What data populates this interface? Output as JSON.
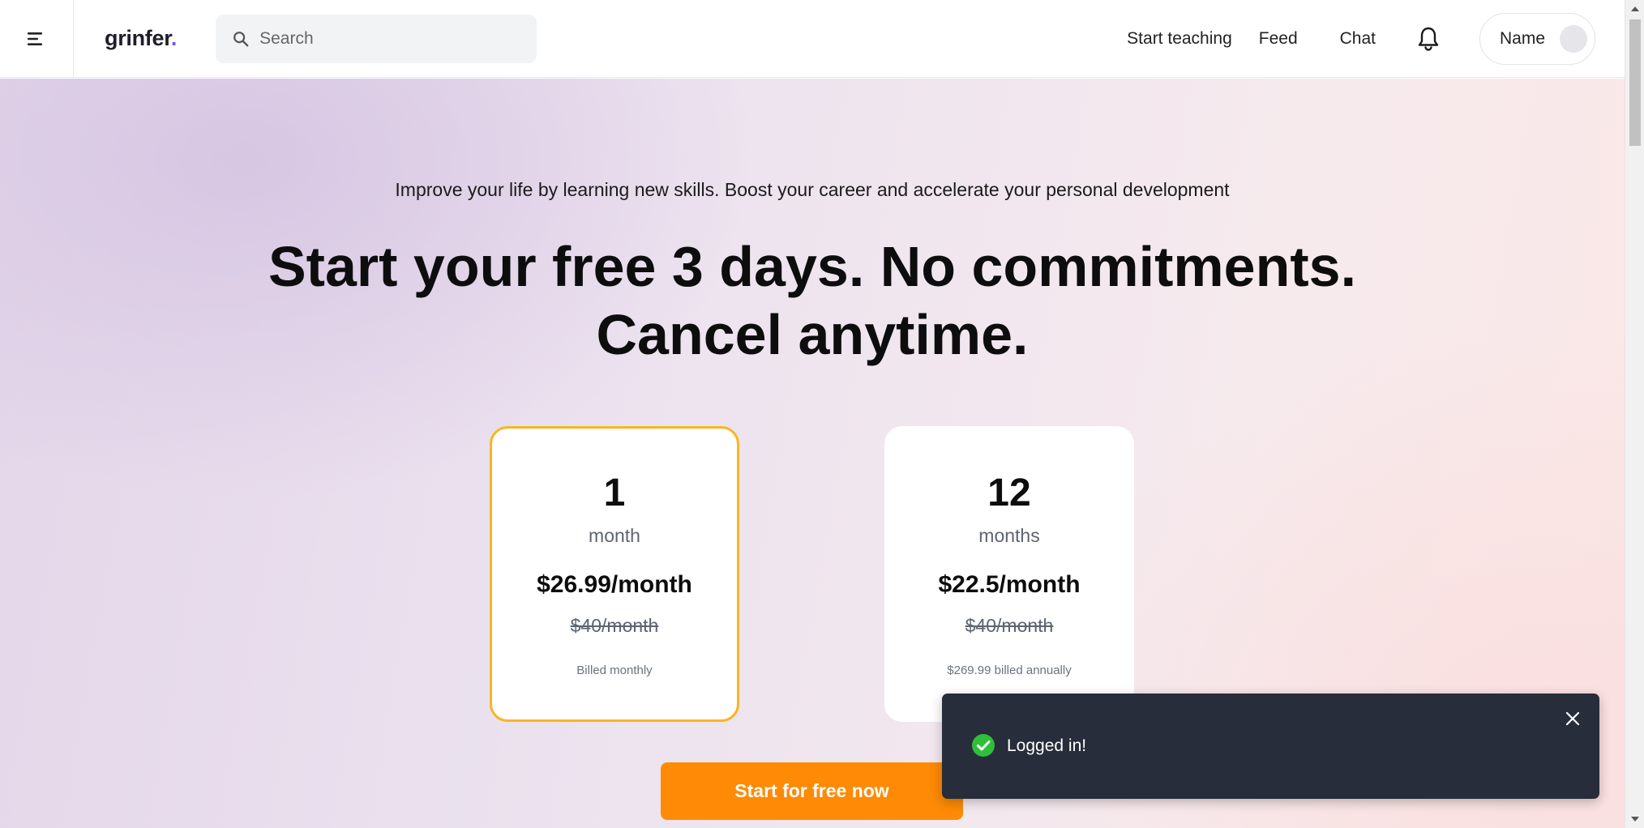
{
  "header": {
    "logo_text": "grinfer",
    "logo_dot": ".",
    "logo_accent": "#7b52e8",
    "search_placeholder": "Search",
    "nav": {
      "start_teaching": "Start teaching",
      "feed": "Feed",
      "chat": "Chat"
    },
    "profile_name": "Name"
  },
  "hero": {
    "subtitle": "Improve your life by learning new skills. Boost your career and accelerate your personal development",
    "headline_line1": "Start your free 3 days. No commitments.",
    "headline_line2": "Cancel anytime."
  },
  "plans": [
    {
      "number": "1",
      "unit": "month",
      "price": "$26.99/month",
      "old_price": "$40/month",
      "billing": "Billed monthly",
      "selected": true
    },
    {
      "number": "12",
      "unit": "months",
      "price": "$22.5/month",
      "old_price": "$40/month",
      "billing": "$269.99 billed annually",
      "selected": false
    }
  ],
  "cta_label": "Start for free now",
  "toast": {
    "message": "Logged in!",
    "status_color": "#2fbf3a"
  },
  "colors": {
    "cta": "#fe8a05",
    "selected_border": "#f9b522",
    "toast_bg": "#272d3a"
  }
}
